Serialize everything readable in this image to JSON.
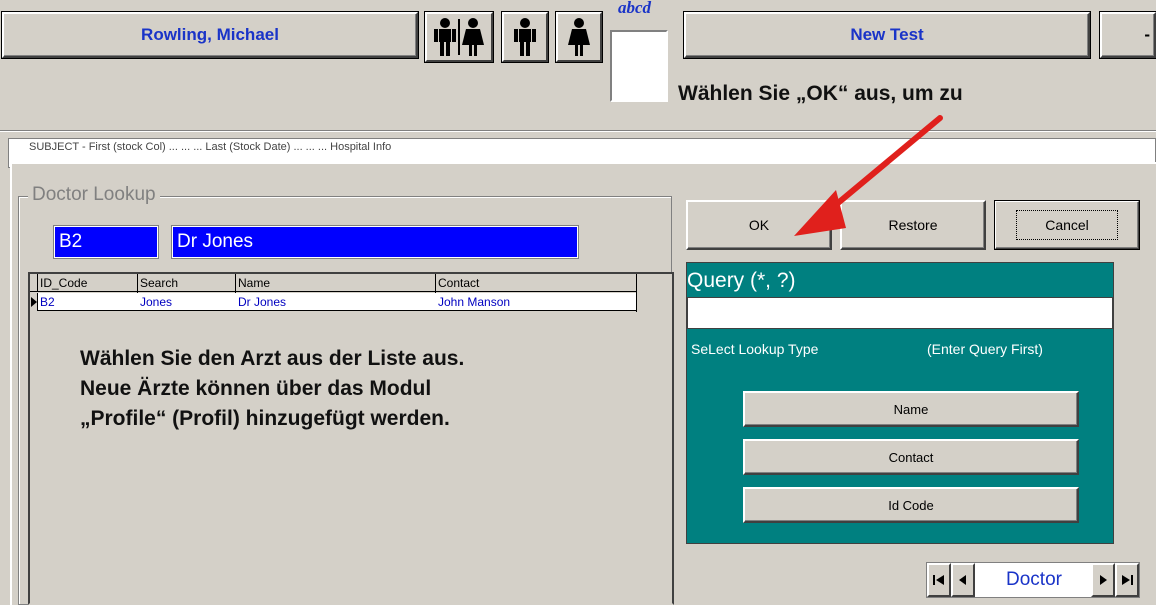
{
  "header": {
    "patient_name": "Rowling, Michael",
    "abcd_label": "abcd",
    "new_test_label": "New Test",
    "partial_button_label": "-",
    "background_strip_text": "SUBJECT - First (stock Col) ... ... ... Last (Stock Date) ... ... ... Hospital Info"
  },
  "annotations": {
    "ok_instruction": "Wählen Sie „OK“ aus, um zu",
    "list_instruction": [
      "Wählen Sie den Arzt aus der Liste aus.",
      "Neue Ärzte können über das Modul",
      "„Profile“ (Profil) hinzugefügt werden."
    ],
    "arrow_color": "#e0201c"
  },
  "dialog": {
    "title": "Doctor Lookup",
    "selected_code": "B2",
    "selected_name": "Dr Jones",
    "buttons": {
      "ok": "OK",
      "restore": "Restore",
      "cancel": "Cancel"
    },
    "grid": {
      "columns": [
        "ID_Code",
        "Search",
        "Name",
        "Contact"
      ],
      "rows": [
        {
          "id_code": "B2",
          "search": "Jones",
          "name": "Dr Jones",
          "contact": "John Manson"
        }
      ]
    },
    "query": {
      "title": "Query (*, ?)",
      "value": "",
      "lookup_type_label": "SeLect Lookup Type",
      "lookup_hint": "(Enter Query First)",
      "type_buttons": [
        "Name",
        "Contact",
        "Id Code"
      ]
    },
    "navigator": {
      "label": "Doctor"
    }
  },
  "colors": {
    "window_bg": "#d4d0c8",
    "selection_blue": "#0000ff",
    "teal_panel": "#008080",
    "link_blue": "#1a34c8"
  }
}
